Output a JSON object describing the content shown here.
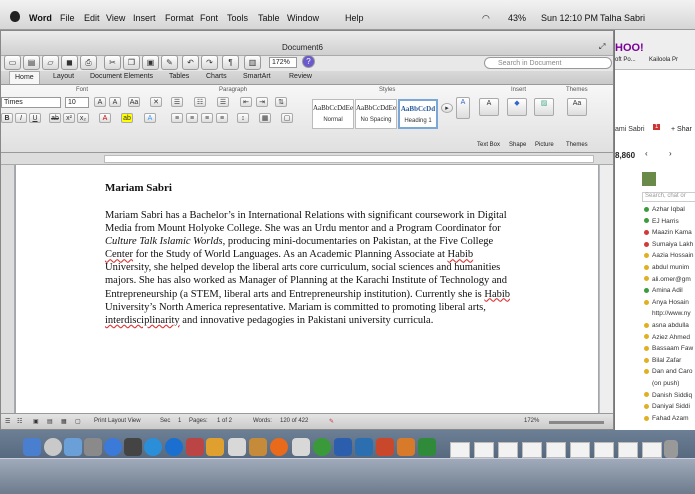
{
  "menubar": {
    "app_name": "Word",
    "items": [
      "File",
      "Edit",
      "View",
      "Insert",
      "Format",
      "Font",
      "Tools",
      "Table",
      "Window",
      "Help"
    ],
    "battery": "43%",
    "clock": "Sun 12:10 PM",
    "user": "Talha Sabri"
  },
  "window": {
    "doc_title": "Document6",
    "zoom": "172%",
    "search_placeholder": "Search in Document"
  },
  "ribbon": {
    "tabs": [
      "Home",
      "Layout",
      "Document Elements",
      "Tables",
      "Charts",
      "SmartArt",
      "Review"
    ],
    "group_labels": {
      "font": "Font",
      "paragraph": "Paragraph",
      "styles": "Styles",
      "insert": "Insert",
      "themes": "Themes"
    },
    "font_name": "Times",
    "font_size": "10",
    "styles": [
      {
        "preview": "AaBbCcDdEe",
        "name": "Normal"
      },
      {
        "preview": "AaBbCcDdEe",
        "name": "No Spacing"
      },
      {
        "preview": "AaBbCcDd",
        "name": "Heading 1"
      }
    ],
    "insert_items": [
      "Text Box",
      "Shape",
      "Picture"
    ],
    "themes_label": "Themes"
  },
  "document": {
    "title": "Mariam Sabri",
    "p1": "Mariam Sabri has a Bachelor’s in International Relations with significant coursework in Digital Media from Mount Holyoke College. She was an Urdu mentor and a Program Coordinator for ",
    "italic": "Culture Talk Islamic Worlds",
    "p2": ", producing mini-documentaries on Pakistan, at the Five College ",
    "center": "Center",
    "p3": " for the Study of World Languages. As an Academic Planning Associate at ",
    "habib1": "Habib",
    "p4": " University, she helped develop the liberal arts core curriculum, social sciences and humanities majors. She has also worked as Manager of Planning at the Karachi Institute of Technology and Entrepreneurship (a STEM, liberal arts and Entrepreneurship institution). Currently she is ",
    "habib2": "Habib",
    "p5": " University’s North America representative. Mariam is committed to promoting liberal arts, ",
    "inter": "interdisciplinarity",
    "p6": " and innovative pedagogies in Pakistani university curricula."
  },
  "status": {
    "view": "Print Layout View",
    "sec_label": "Sec",
    "sec_value": "1",
    "pages_label": "Pages:",
    "pages_value": "1 of 2",
    "words_label": "Words:",
    "words_value": "120 of 422",
    "zoom": "172%"
  },
  "sidebar": {
    "logo": "HOO!",
    "tabs": [
      "oft Po...",
      "Kailoola Pr"
    ],
    "name": "ami Sabri",
    "notif": "1",
    "share": "+ Shar",
    "count": "8,860",
    "search_placeholder": "Search, chat or",
    "contacts": [
      {
        "name": "Azhar Iqbal",
        "status": "green"
      },
      {
        "name": "EJ Harris",
        "status": "green"
      },
      {
        "name": "Maazin Kama",
        "status": "red"
      },
      {
        "name": "Sumaiya Lakh",
        "status": "red"
      },
      {
        "name": "Aazia Hossain",
        "status": "yellow"
      },
      {
        "name": "abdul munim",
        "status": "yellow"
      },
      {
        "name": "ali.omer@gm",
        "status": "yellow"
      },
      {
        "name": "Amina Adil",
        "status": "green"
      },
      {
        "name": "Anya Hosain",
        "status": "yellow"
      },
      {
        "name": "http://www.ny",
        "status": "none"
      },
      {
        "name": "asna abdulla",
        "status": "yellow"
      },
      {
        "name": "Aziez Ahmed",
        "status": "yellow"
      },
      {
        "name": "Bassaam Faw",
        "status": "yellow"
      },
      {
        "name": "Bilal Zafar",
        "status": "yellow"
      },
      {
        "name": "Dan and Caro",
        "status": "yellow"
      },
      {
        "name": "(on push)",
        "status": "none"
      },
      {
        "name": "Danish Siddiq",
        "status": "yellow"
      },
      {
        "name": "Daniyal Siddi",
        "status": "yellow"
      },
      {
        "name": "Fahad Azam",
        "status": "yellow"
      }
    ]
  },
  "colors": {
    "accent": "#3b5998",
    "green": "#3c9b3c",
    "red": "#d23a3a",
    "yellow": "#e0b020"
  }
}
